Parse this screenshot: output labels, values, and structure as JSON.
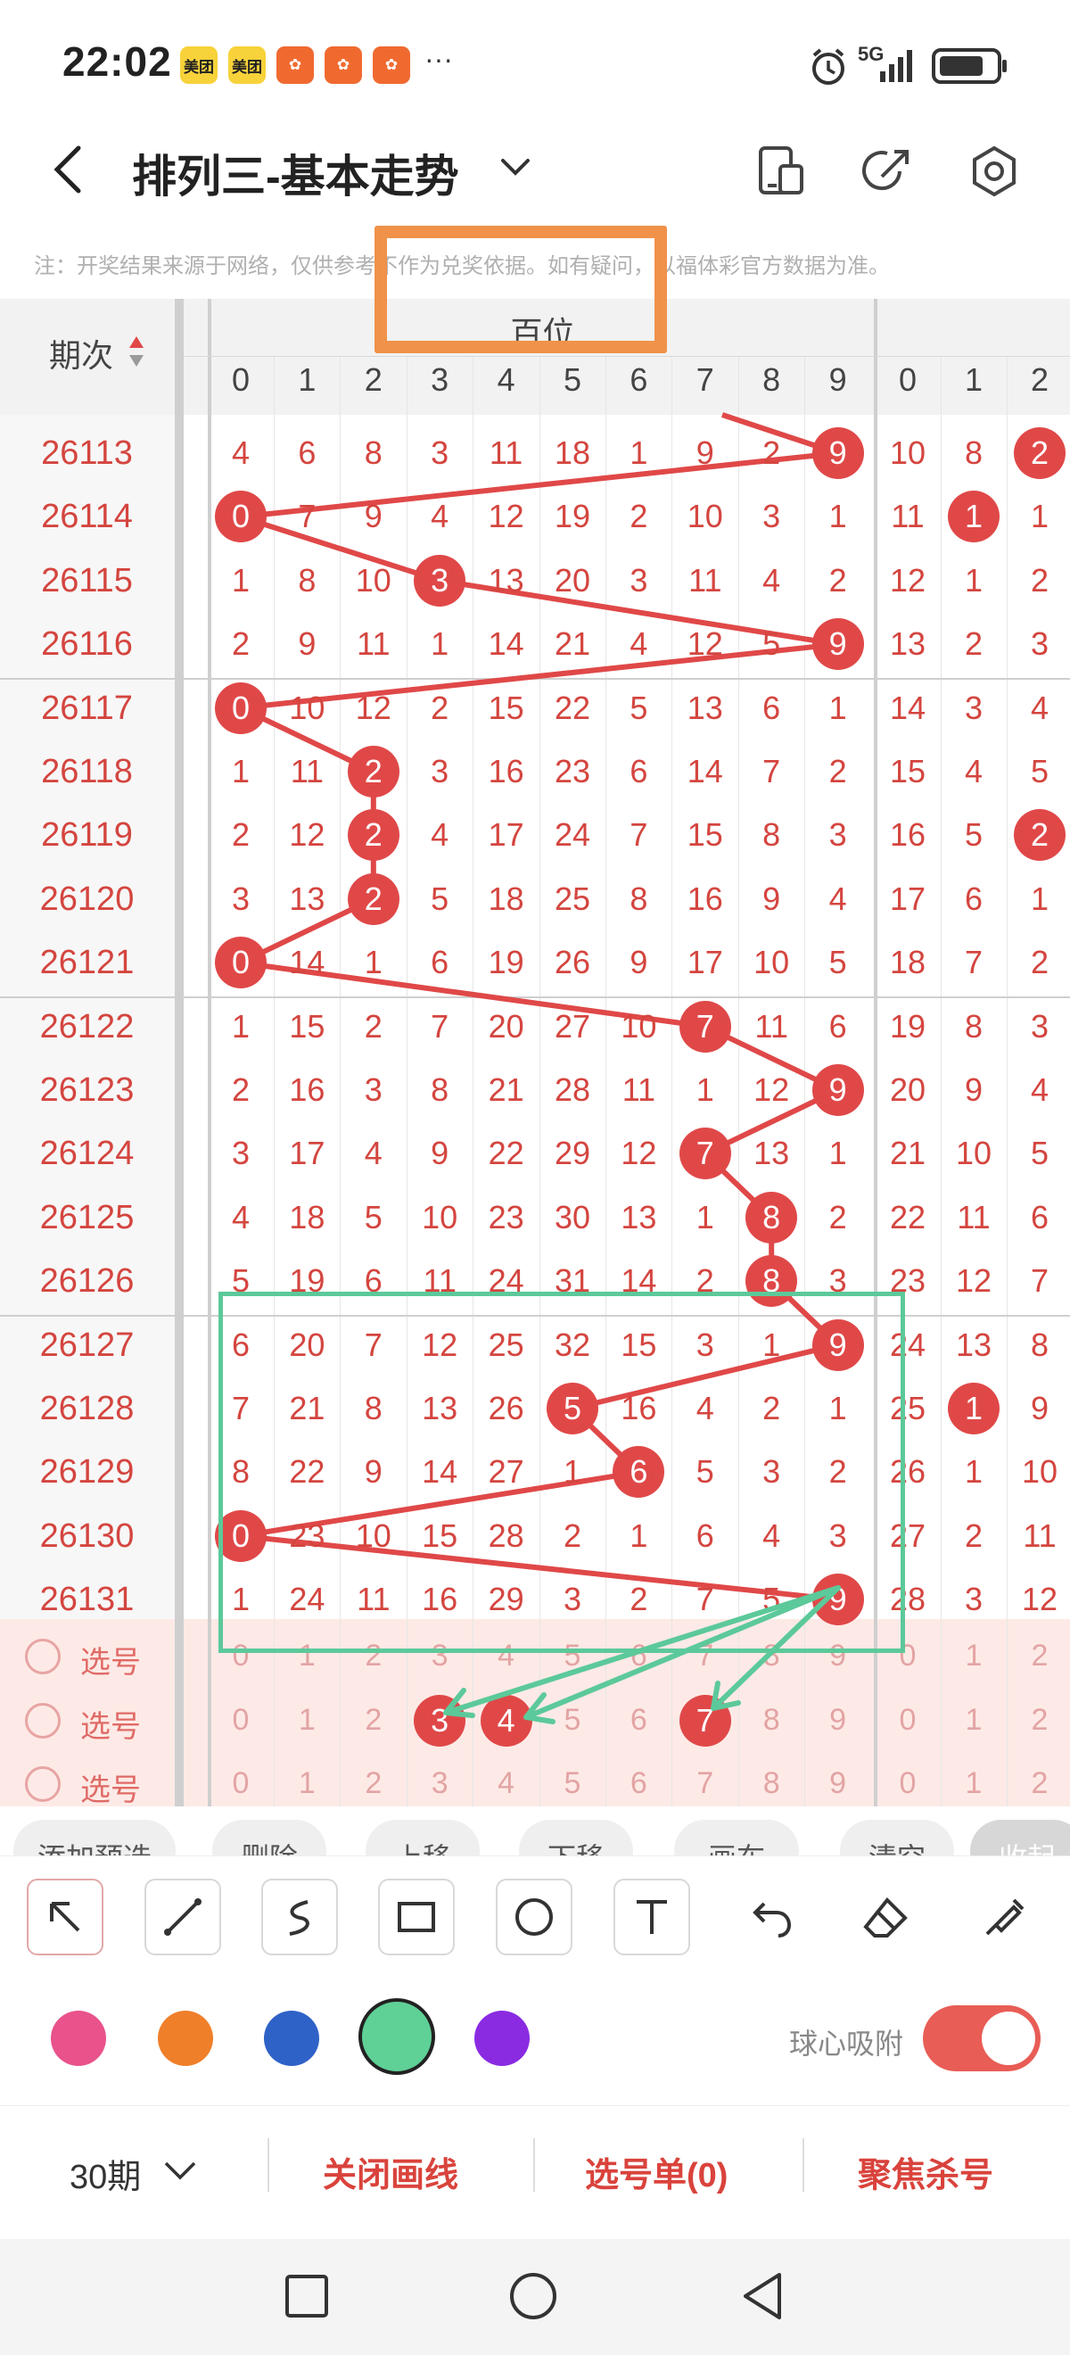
{
  "status_bar": {
    "time": "22:02",
    "badges": [
      "美团",
      "美团",
      "",
      "",
      ""
    ],
    "more": "···",
    "network": "5G"
  },
  "header": {
    "title": "排列三-基本走势",
    "back_icon": "back-arrow-icon",
    "dropdown_icon": "chevron-down-icon",
    "actions": [
      "device-layout-icon",
      "share-icon",
      "settings-icon"
    ]
  },
  "notice": "注：开奖结果来源于网络，仅供参考不作为兑奖依据。如有疑问，以福体彩官方数据为准。",
  "table": {
    "period_header": "期次",
    "group_header": "百位",
    "digits": [
      "0",
      "1",
      "2",
      "3",
      "4",
      "5",
      "6",
      "7",
      "8",
      "9"
    ],
    "next_digits": [
      "0",
      "1",
      "2"
    ],
    "rows": [
      {
        "period": "26113",
        "cells": [
          "4",
          "6",
          "8",
          "3",
          "11",
          "18",
          "1",
          "9",
          "2",
          "9"
        ],
        "ball": 9,
        "next": [
          "10",
          "8",
          "2"
        ],
        "next_ball": 2
      },
      {
        "period": "26114",
        "cells": [
          "0",
          "7",
          "9",
          "4",
          "12",
          "19",
          "2",
          "10",
          "3",
          "1"
        ],
        "ball": 0,
        "next": [
          "11",
          "1",
          "1"
        ],
        "next_ball": 1
      },
      {
        "period": "26115",
        "cells": [
          "1",
          "8",
          "10",
          "3",
          "13",
          "20",
          "3",
          "11",
          "4",
          "2"
        ],
        "ball": 3,
        "next": [
          "12",
          "1",
          "2"
        ],
        "next_ball": -1
      },
      {
        "period": "26116",
        "cells": [
          "2",
          "9",
          "11",
          "1",
          "14",
          "21",
          "4",
          "12",
          "5",
          "9"
        ],
        "ball": 9,
        "next": [
          "13",
          "2",
          "3"
        ],
        "next_ball": -1
      },
      {
        "period": "26117",
        "cells": [
          "0",
          "10",
          "12",
          "2",
          "15",
          "22",
          "5",
          "13",
          "6",
          "1"
        ],
        "ball": 0,
        "next": [
          "14",
          "3",
          "4"
        ],
        "next_ball": -1
      },
      {
        "period": "26118",
        "cells": [
          "1",
          "11",
          "2",
          "3",
          "16",
          "23",
          "6",
          "14",
          "7",
          "2"
        ],
        "ball": 2,
        "next": [
          "15",
          "4",
          "5"
        ],
        "next_ball": -1
      },
      {
        "period": "26119",
        "cells": [
          "2",
          "12",
          "2",
          "4",
          "17",
          "24",
          "7",
          "15",
          "8",
          "3"
        ],
        "ball": 2,
        "next": [
          "16",
          "5",
          "2"
        ],
        "next_ball": 2
      },
      {
        "period": "26120",
        "cells": [
          "3",
          "13",
          "2",
          "5",
          "18",
          "25",
          "8",
          "16",
          "9",
          "4"
        ],
        "ball": 2,
        "next": [
          "17",
          "6",
          "1"
        ],
        "next_ball": -1
      },
      {
        "period": "26121",
        "cells": [
          "0",
          "14",
          "1",
          "6",
          "19",
          "26",
          "9",
          "17",
          "10",
          "5"
        ],
        "ball": 0,
        "next": [
          "18",
          "7",
          "2"
        ],
        "next_ball": -1
      },
      {
        "period": "26122",
        "cells": [
          "1",
          "15",
          "2",
          "7",
          "20",
          "27",
          "10",
          "7",
          "11",
          "6"
        ],
        "ball": 7,
        "next": [
          "19",
          "8",
          "3"
        ],
        "next_ball": -1
      },
      {
        "period": "26123",
        "cells": [
          "2",
          "16",
          "3",
          "8",
          "21",
          "28",
          "11",
          "1",
          "12",
          "9"
        ],
        "ball": 9,
        "next": [
          "20",
          "9",
          "4"
        ],
        "next_ball": -1
      },
      {
        "period": "26124",
        "cells": [
          "3",
          "17",
          "4",
          "9",
          "22",
          "29",
          "12",
          "7",
          "13",
          "1"
        ],
        "ball": 7,
        "next": [
          "21",
          "10",
          "5"
        ],
        "next_ball": -1
      },
      {
        "period": "26125",
        "cells": [
          "4",
          "18",
          "5",
          "10",
          "23",
          "30",
          "13",
          "1",
          "8",
          "2"
        ],
        "ball": 8,
        "next": [
          "22",
          "11",
          "6"
        ],
        "next_ball": -1
      },
      {
        "period": "26126",
        "cells": [
          "5",
          "19",
          "6",
          "11",
          "24",
          "31",
          "14",
          "2",
          "8",
          "3"
        ],
        "ball": 8,
        "next": [
          "23",
          "12",
          "7"
        ],
        "next_ball": -1
      },
      {
        "period": "26127",
        "cells": [
          "6",
          "20",
          "7",
          "12",
          "25",
          "32",
          "15",
          "3",
          "1",
          "9"
        ],
        "ball": 9,
        "next": [
          "24",
          "13",
          "8"
        ],
        "next_ball": -1
      },
      {
        "period": "26128",
        "cells": [
          "7",
          "21",
          "8",
          "13",
          "26",
          "5",
          "16",
          "4",
          "2",
          "1"
        ],
        "ball": 5,
        "next": [
          "25",
          "1",
          "9"
        ],
        "next_ball": 1
      },
      {
        "period": "26129",
        "cells": [
          "8",
          "22",
          "9",
          "14",
          "27",
          "1",
          "6",
          "5",
          "3",
          "2"
        ],
        "ball": 6,
        "next": [
          "26",
          "1",
          "10"
        ],
        "next_ball": -1
      },
      {
        "period": "26130",
        "cells": [
          "0",
          "23",
          "10",
          "15",
          "28",
          "2",
          "1",
          "6",
          "4",
          "3"
        ],
        "ball": 0,
        "next": [
          "27",
          "2",
          "11"
        ],
        "next_ball": -1
      },
      {
        "period": "26131",
        "cells": [
          "1",
          "24",
          "11",
          "16",
          "29",
          "3",
          "2",
          "7",
          "5",
          "9"
        ],
        "ball": 9,
        "next": [
          "28",
          "3",
          "12"
        ],
        "next_ball": -1
      }
    ],
    "pick_rows": [
      {
        "label": "选号",
        "selected": []
      },
      {
        "label": "选号",
        "selected": [
          3,
          4,
          7
        ]
      },
      {
        "label": "选号",
        "selected": []
      }
    ]
  },
  "chips": [
    "添加预选",
    "删除",
    "上移",
    "下移",
    "画布",
    "清空",
    "收起"
  ],
  "tools": [
    "pointer-arrow-icon",
    "line-icon",
    "freehand-icon",
    "rectangle-icon",
    "circle-icon",
    "text-icon",
    "undo-icon",
    "eraser-icon",
    "brush-icon"
  ],
  "colors": [
    "#e9528b",
    "#f07f2a",
    "#2f62c7",
    "#5fd096",
    "#8a2be2"
  ],
  "selected_color": "#5fd096",
  "snap_label": "球心吸附",
  "snap_on": true,
  "bottom": {
    "period_select": "30期",
    "close_lines": "关闭画线",
    "pick_list": "选号单(0)",
    "focus_kill": "聚焦杀号"
  },
  "nav": [
    "recent-apps-icon",
    "home-icon",
    "back-icon"
  ]
}
